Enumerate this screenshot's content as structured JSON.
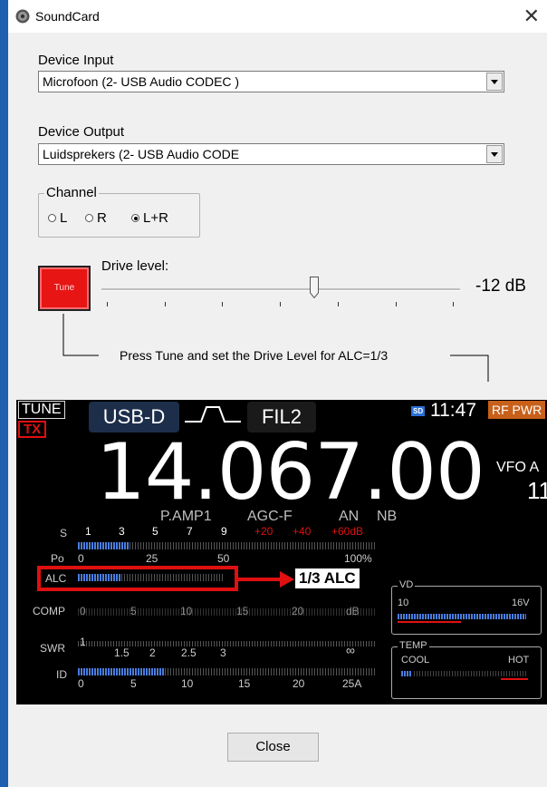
{
  "window": {
    "title": "SoundCard",
    "close_glyph": "✕"
  },
  "device_input": {
    "label": "Device Input",
    "value": "Microfoon (2- USB Audio CODEC )"
  },
  "device_output": {
    "label": "Device Output",
    "value": "Luidsprekers (2- USB Audio CODE"
  },
  "channel": {
    "label": "Channel",
    "options": [
      "L",
      "R",
      "L+R"
    ],
    "selected": "L+R"
  },
  "tune": {
    "button_label": "Tune",
    "drive_label": "Drive level:",
    "drive_value": "-12 dB",
    "hint": "Press Tune and set the Drive Level for ALC=1/3"
  },
  "radio": {
    "tune_tag": "TUNE",
    "tx_tag": "TX",
    "mode": "USB-D",
    "filter": "FIL2",
    "sd": "SD",
    "time": "11:47",
    "rf_pwr": "RF PWR",
    "frequency": "14.067.00",
    "vfo": "VFO A",
    "vfo_num": "11",
    "status": [
      "P.AMP1",
      "AGC-F",
      "AN",
      "NB"
    ],
    "s_scale": [
      "1",
      "3",
      "5",
      "7",
      "9",
      "+20",
      "+40",
      "+60dB"
    ],
    "po_scale": [
      "0",
      "25",
      "50",
      "100%"
    ],
    "comp_scale": [
      "0",
      "5",
      "10",
      "15",
      "20",
      "dB"
    ],
    "swr_scale": [
      "1",
      "1.5",
      "2",
      "2.5",
      "3",
      "∞"
    ],
    "id_scale": [
      "0",
      "5",
      "10",
      "15",
      "20",
      "25A"
    ],
    "meter_labels": {
      "s": "S",
      "po": "Po",
      "alc": "ALC",
      "comp": "COMP",
      "swr": "SWR",
      "id": "ID"
    },
    "alc_callout": "1/3 ALC",
    "vd": {
      "label": "VD",
      "min": "10",
      "max": "16V"
    },
    "temp": {
      "label": "TEMP",
      "cool": "COOL",
      "hot": "HOT"
    }
  },
  "footer": {
    "close_label": "Close"
  },
  "colors": {
    "accent_blue": "#1e5fb0",
    "tune_red": "#e81515",
    "callout_red": "#e01010",
    "meter_blue": "#4a7de0",
    "rf_pwr": "#c8601a"
  }
}
